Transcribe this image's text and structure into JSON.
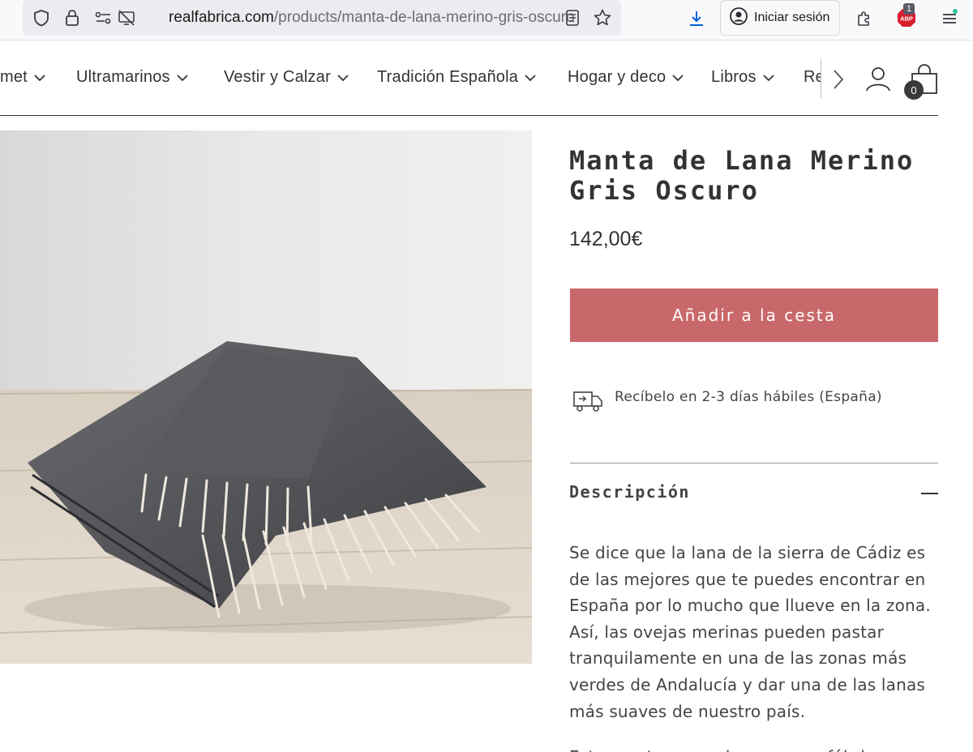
{
  "browser": {
    "url_domain": "realfabrica.com",
    "url_path": "/products/manta-de-lana-merino-gris-oscuro",
    "signin_label": "Iniciar sesión",
    "adblock_count": "1",
    "adblock_label": "ABP"
  },
  "nav": {
    "items": [
      {
        "label": "met"
      },
      {
        "label": "Ultramarinos"
      },
      {
        "label": "Vestir y Calzar"
      },
      {
        "label": "Tradición Española"
      },
      {
        "label": "Hogar y deco"
      },
      {
        "label": "Libros"
      },
      {
        "label": "Re"
      }
    ],
    "cart_count": "0"
  },
  "product": {
    "title": "Manta de Lana Merino Gris Oscuro",
    "price": "142,00€",
    "add_to_cart_label": "Añadir a la cesta",
    "delivery_text": "Recíbelo en 2-3 días hábiles (España)",
    "description_heading": "Descripción",
    "description_paragraph": "Se dice que la lana de la sierra de Cádiz es de las mejores que te puedes encontrar en España por lo mucho que llueve en la zona. Así, las ovejas merinas pueden pastar tranquilamente en una de las zonas más verdes de Andalucía y dar una de las lanas más suaves de nuestro país.",
    "description_paragraph_2": "Esta manta se produce en una fábrica"
  },
  "colors": {
    "accent_button": "#c9686a",
    "text": "#333333"
  }
}
